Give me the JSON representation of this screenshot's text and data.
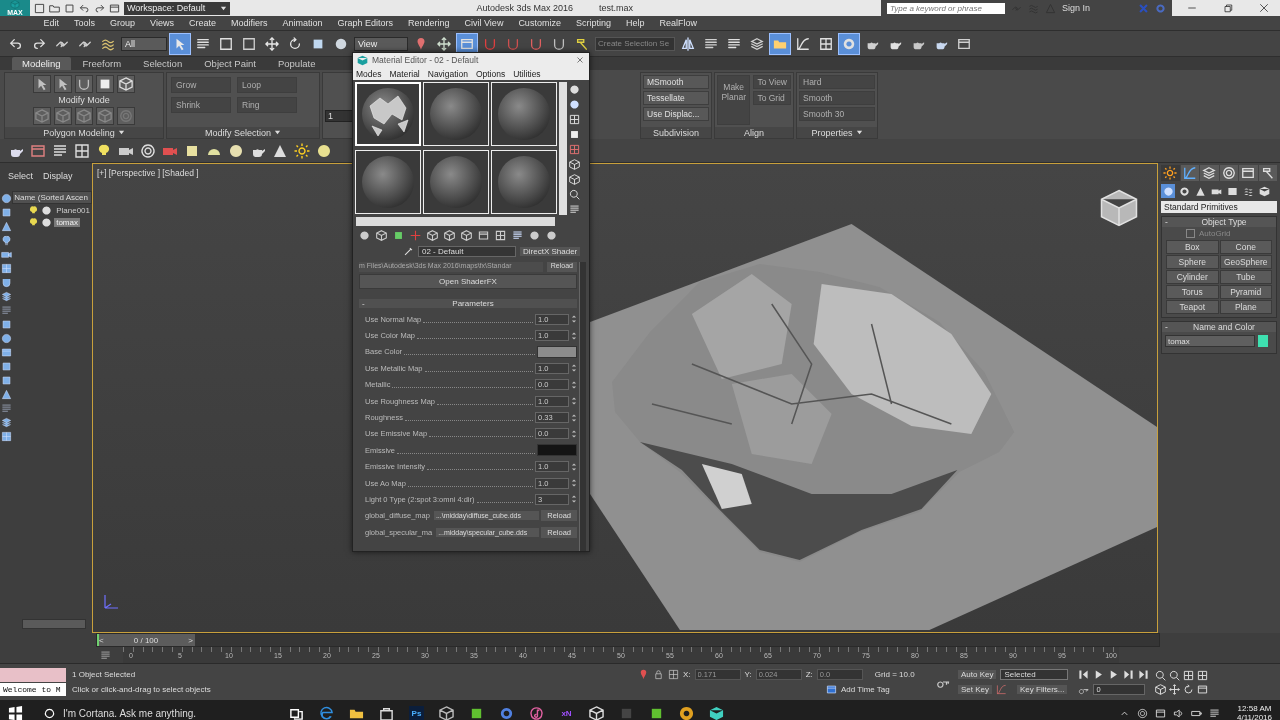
{
  "title_bar": {
    "logo_text": "MAX",
    "workspace": "Workspace: Default",
    "app_title": "Autodesk 3ds Max 2016",
    "file_name": "test.max",
    "search": {
      "placeholder": "Type a keyword or phrase"
    },
    "sign_in": "Sign In"
  },
  "menu": [
    "Edit",
    "Tools",
    "Group",
    "Views",
    "Create",
    "Modifiers",
    "Animation",
    "Graph Editors",
    "Rendering",
    "Civil View",
    "Customize",
    "Scripting",
    "Help",
    "RealFlow"
  ],
  "main_toolbar": {
    "buttons_a": [
      {
        "selected": false
      },
      {
        "selected": false
      },
      {
        "selected": false
      },
      {
        "selected": false
      },
      {
        "selected": false
      }
    ],
    "selection_filter": "All",
    "buttons_b": [
      {
        "selected": true
      },
      {
        "selected": false
      },
      {
        "selected": false
      },
      {
        "selected": false
      },
      {
        "selected": false
      },
      {
        "selected": false
      },
      {
        "selected": false
      },
      {
        "selected": false
      }
    ],
    "reference_coord": "View",
    "buttons_c": [
      {
        "selected": false
      },
      {
        "selected": false
      },
      {
        "selected": true
      },
      {
        "selected": false
      },
      {
        "selected": false
      },
      {
        "selected": false
      },
      {
        "selected": false
      },
      {
        "selected": false
      }
    ],
    "named_selection": {
      "placeholder": "Create Selection Se"
    },
    "buttons_d": [
      {
        "selected": false
      },
      {
        "selected": false
      },
      {
        "selected": false
      },
      {
        "selected": false
      },
      {
        "selected": true
      },
      {
        "selected": false
      },
      {
        "selected": false
      },
      {
        "selected": true
      },
      {
        "selected": false
      },
      {
        "selected": false
      },
      {
        "selected": false
      },
      {
        "selected": false
      },
      {
        "selected": false
      }
    ]
  },
  "ribbon": {
    "tabs": [
      {
        "label": "Modeling",
        "selected": true
      },
      {
        "label": "Freeform",
        "selected": false
      },
      {
        "label": "Selection",
        "selected": false
      },
      {
        "label": "Object Paint",
        "selected": false
      },
      {
        "label": "Populate",
        "selected": false
      }
    ],
    "polygon_modeling": {
      "title": "Polygon Modeling",
      "mode_label": "Modify Mode"
    },
    "modify_selection": {
      "title": "Modify Selection",
      "items": [
        {
          "label": "Grow",
          "disabled": true
        },
        {
          "label": "Shrink",
          "disabled": true
        },
        {
          "label": "Loop",
          "disabled": true
        },
        {
          "label": "Ring",
          "disabled": true
        }
      ]
    },
    "spinner": "1",
    "subdivision": {
      "title": "Subdivision",
      "items": [
        {
          "label": "MSmooth",
          "disabled": false
        },
        {
          "label": "Tessellate",
          "disabled": false
        },
        {
          "label": "Use Displac...",
          "disabled": false
        }
      ]
    },
    "align": {
      "title": "Align",
      "items": [
        {
          "label": "To View",
          "disabled": true
        },
        {
          "label": "To Grid",
          "disabled": true
        }
      ],
      "big": {
        "label": "Make Planar",
        "disabled": true
      }
    },
    "properties": {
      "title": "Properties",
      "items": [
        {
          "label": "Hard",
          "disabled": true
        },
        {
          "label": "Smooth",
          "disabled": true
        },
        {
          "label": "Smooth 30",
          "disabled": true
        }
      ]
    }
  },
  "scene_explorer": {
    "tabs": [
      "Select",
      "Display"
    ],
    "column": "Name (Sorted Ascen",
    "rows": [
      {
        "name": "Plane001",
        "selected": false
      },
      {
        "name": "tomax",
        "selected": true
      }
    ]
  },
  "viewport": {
    "labels": [
      "[+]",
      "[Perspective ]",
      "[Shaded ]"
    ]
  },
  "material_editor": {
    "title": "Material Editor - 02 - Default",
    "menu": [
      "Modes",
      "Material",
      "Navigation",
      "Options",
      "Utilities"
    ],
    "slots": [
      {
        "kind": "textured",
        "selected": true
      },
      {
        "kind": "plain",
        "selected": false
      },
      {
        "kind": "plain",
        "selected": false
      },
      {
        "kind": "plain",
        "selected": false
      },
      {
        "kind": "plain",
        "selected": false
      },
      {
        "kind": "plain",
        "selected": false
      }
    ],
    "material_name": "02 - Default",
    "shader_button": "DirectX Shader",
    "fx_path": "m Files\\Autodesk\\3ds Max 2016\\maps\\fx\\Standar",
    "path_reload": "Reload",
    "open_shaderfx": "Open ShaderFX",
    "rollout_toggle": "-",
    "rollout_title": "Parameters",
    "params": [
      {
        "kind": "spinner",
        "label": "Use Normal Map",
        "value": "1.0"
      },
      {
        "kind": "spinner",
        "label": "Use Color Map",
        "value": "1.0"
      },
      {
        "kind": "color",
        "label": "Base Color",
        "color": "#8c8c8c"
      },
      {
        "kind": "spinner",
        "label": "Use Metallic Map",
        "value": "1.0"
      },
      {
        "kind": "spinner",
        "label": "Metallic",
        "value": "0.0"
      },
      {
        "kind": "spinner",
        "label": "Use Roughness Map",
        "value": "1.0"
      },
      {
        "kind": "spinner",
        "label": "Roughness",
        "value": "0.33"
      },
      {
        "kind": "spinner",
        "label": "Use Emissive Map",
        "value": "0.0"
      },
      {
        "kind": "color",
        "label": "Emissive",
        "color": "#141414"
      },
      {
        "kind": "spinner",
        "label": "Emissive Intensity",
        "value": "1.0"
      },
      {
        "kind": "spinner",
        "label": "Use Ao Map",
        "value": "1.0"
      },
      {
        "kind": "spinner",
        "label": "Light 0 Type (2:spot 3:omni 4:dir)",
        "value": "3"
      },
      {
        "kind": "map",
        "label": "global_diffuse_map",
        "value": "...\\midday\\diffuse_cube.dds",
        "button": "Reload"
      },
      {
        "kind": "map",
        "label": "global_specular_ma",
        "value": "...midday\\specular_cube.dds",
        "button": "Reload"
      }
    ]
  },
  "command_panel": {
    "tabs": [
      {
        "selected": true
      },
      {
        "selected": false
      },
      {
        "selected": false
      },
      {
        "selected": false
      },
      {
        "selected": false
      },
      {
        "selected": false
      }
    ],
    "categories": [
      {
        "selected": true
      },
      {
        "selected": false
      },
      {
        "selected": false
      },
      {
        "selected": false
      },
      {
        "selected": false
      },
      {
        "selected": false
      },
      {
        "selected": false
      }
    ],
    "dropdown": "Standard Primitives",
    "object_type": {
      "toggle": "-",
      "title": "Object Type",
      "autogrid": {
        "label": "AutoGrid",
        "checked": false
      },
      "buttons": [
        "Box",
        "Cone",
        "Sphere",
        "GeoSphere",
        "Cylinder",
        "Tube",
        "Torus",
        "Pyramid",
        "Teapot",
        "Plane"
      ]
    },
    "name_color": {
      "toggle": "-",
      "title": "Name and Color",
      "name": "tomax",
      "color": "#3ee0b0"
    }
  },
  "timeline": {
    "slider": {
      "prev": "<",
      "reading": "0 / 100",
      "next": ">",
      "level": 0
    },
    "ticks": [
      "0",
      "5",
      "10",
      "15",
      "20",
      "25",
      "30",
      "35",
      "40",
      "45",
      "50",
      "55",
      "60",
      "65",
      "70",
      "75",
      "80",
      "85",
      "90",
      "95",
      "100"
    ]
  },
  "status_bar": {
    "listener": "Welcome to M",
    "selection": "1 Object Selected",
    "prompt": "Click or click-and-drag to select objects",
    "coords": [
      {
        "axis": "X:",
        "value": "0.171"
      },
      {
        "axis": "Y:",
        "value": "0.024"
      },
      {
        "axis": "Z:",
        "value": "0.0"
      }
    ],
    "grid": "Grid = 10.0",
    "add_time_tag": "Add Time Tag",
    "auto_key": "Auto Key",
    "key_mode": "Selected",
    "set_key": "Set Key",
    "key_filters": "Key Filters...",
    "frame": "0"
  },
  "taskbar": {
    "search_placeholder": "I'm Cortana. Ask me anything.",
    "app_labels": [
      "Ps",
      "xN"
    ],
    "time": "12:58 AM",
    "date": "4/11/2016"
  }
}
